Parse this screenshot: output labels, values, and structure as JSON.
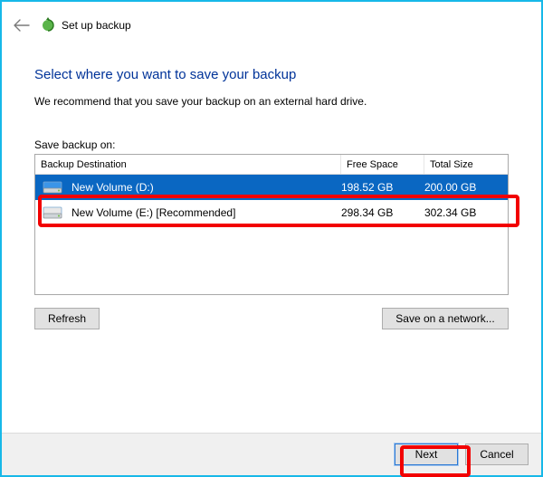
{
  "header": {
    "title": "Set up backup"
  },
  "main": {
    "heading": "Select where you want to save your backup",
    "recommend": "We recommend that you save your backup on an external hard drive.",
    "save_label": "Save backup on:",
    "columns": {
      "dest": "Backup Destination",
      "free": "Free Space",
      "size": "Total Size"
    },
    "rows": [
      {
        "name": "New Volume (D:)",
        "free": "198.52 GB",
        "size": "200.00 GB",
        "selected": true
      },
      {
        "name": "New Volume (E:) [Recommended]",
        "free": "298.34 GB",
        "size": "302.34 GB",
        "selected": false
      }
    ],
    "refresh": "Refresh",
    "network": "Save on a network..."
  },
  "footer": {
    "next": "Next",
    "cancel": "Cancel"
  }
}
